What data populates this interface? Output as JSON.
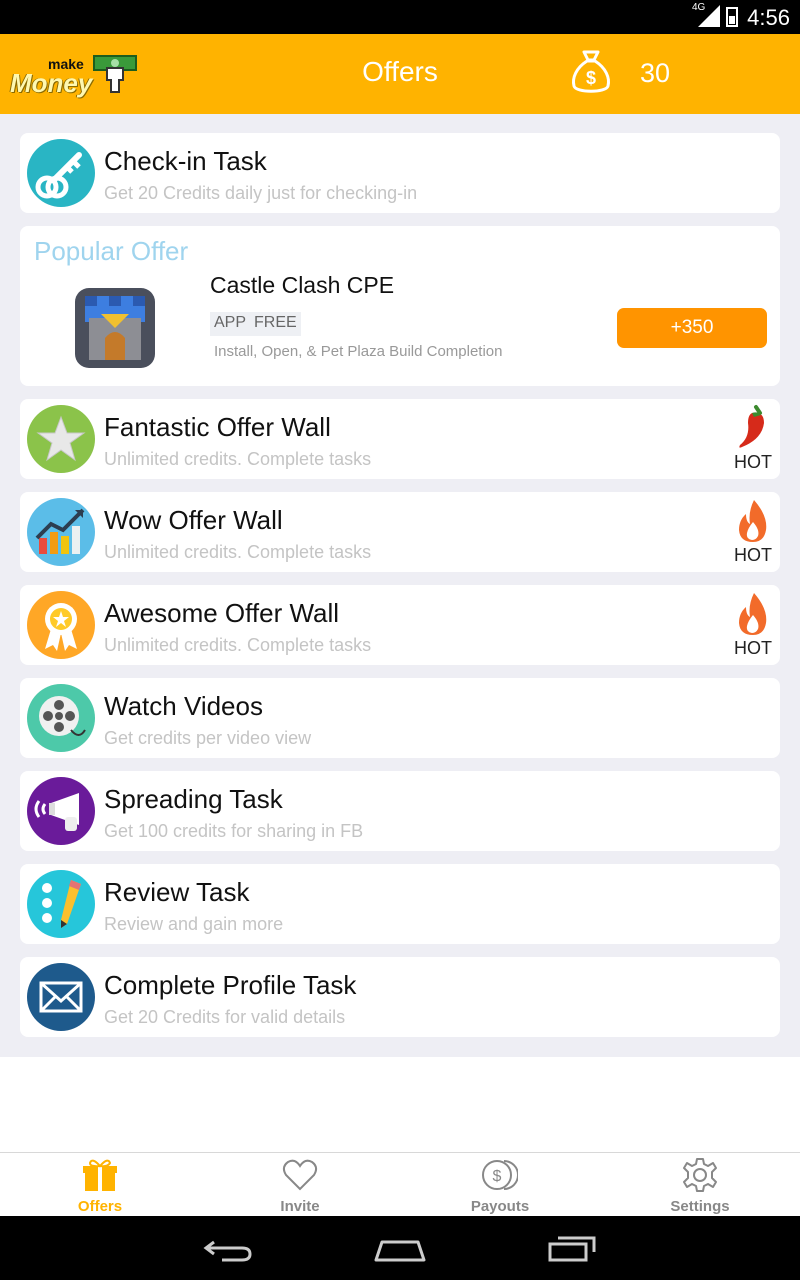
{
  "status_bar": {
    "time": "4:56",
    "network": "4G"
  },
  "app_bar": {
    "logo_top": "make",
    "logo_bottom": "Money",
    "title": "Offers",
    "balance": "30"
  },
  "colors": {
    "accent": "#FFB300",
    "button": "#FF9400",
    "popular_heading": "#9fd4ee"
  },
  "checkin": {
    "title": "Check-in Task",
    "subtitle": "Get 20 Credits daily just for checking-in",
    "icon": "key-icon"
  },
  "popular": {
    "heading": "Popular Offer",
    "name": "Castle Clash CPE",
    "tags": [
      "APP",
      "FREE"
    ],
    "description": "Install, Open, & Pet Plaza Build Completion",
    "button": "+350",
    "icon": "castle-app-icon"
  },
  "offers": [
    {
      "title": "Fantastic Offer Wall",
      "subtitle": "Unlimited credits. Complete tasks",
      "badge": "HOT",
      "icon": "star-icon",
      "badge_icon": "chili-icon"
    },
    {
      "title": "Wow Offer Wall",
      "subtitle": "Unlimited credits. Complete tasks",
      "badge": "HOT",
      "icon": "chart-icon",
      "badge_icon": "flame-icon"
    },
    {
      "title": "Awesome Offer Wall",
      "subtitle": "Unlimited credits. Complete tasks",
      "badge": "HOT",
      "icon": "ribbon-icon",
      "badge_icon": "flame-icon"
    },
    {
      "title": "Watch Videos",
      "subtitle": "Get credits per video view",
      "icon": "film-reel-icon"
    },
    {
      "title": "Spreading Task",
      "subtitle": "Get 100 credits for sharing in FB",
      "icon": "megaphone-icon"
    },
    {
      "title": "Review Task",
      "subtitle": "Review and gain more",
      "icon": "pencil-icon"
    },
    {
      "title": "Complete Profile Task",
      "subtitle": "Get 20 Credits for valid details",
      "icon": "envelope-icon"
    }
  ],
  "bottom_nav": [
    {
      "label": "Offers",
      "icon": "gift-icon",
      "active": true
    },
    {
      "label": "Invite",
      "icon": "heart-icon"
    },
    {
      "label": "Payouts",
      "icon": "coins-icon"
    },
    {
      "label": "Settings",
      "icon": "gear-icon"
    }
  ]
}
